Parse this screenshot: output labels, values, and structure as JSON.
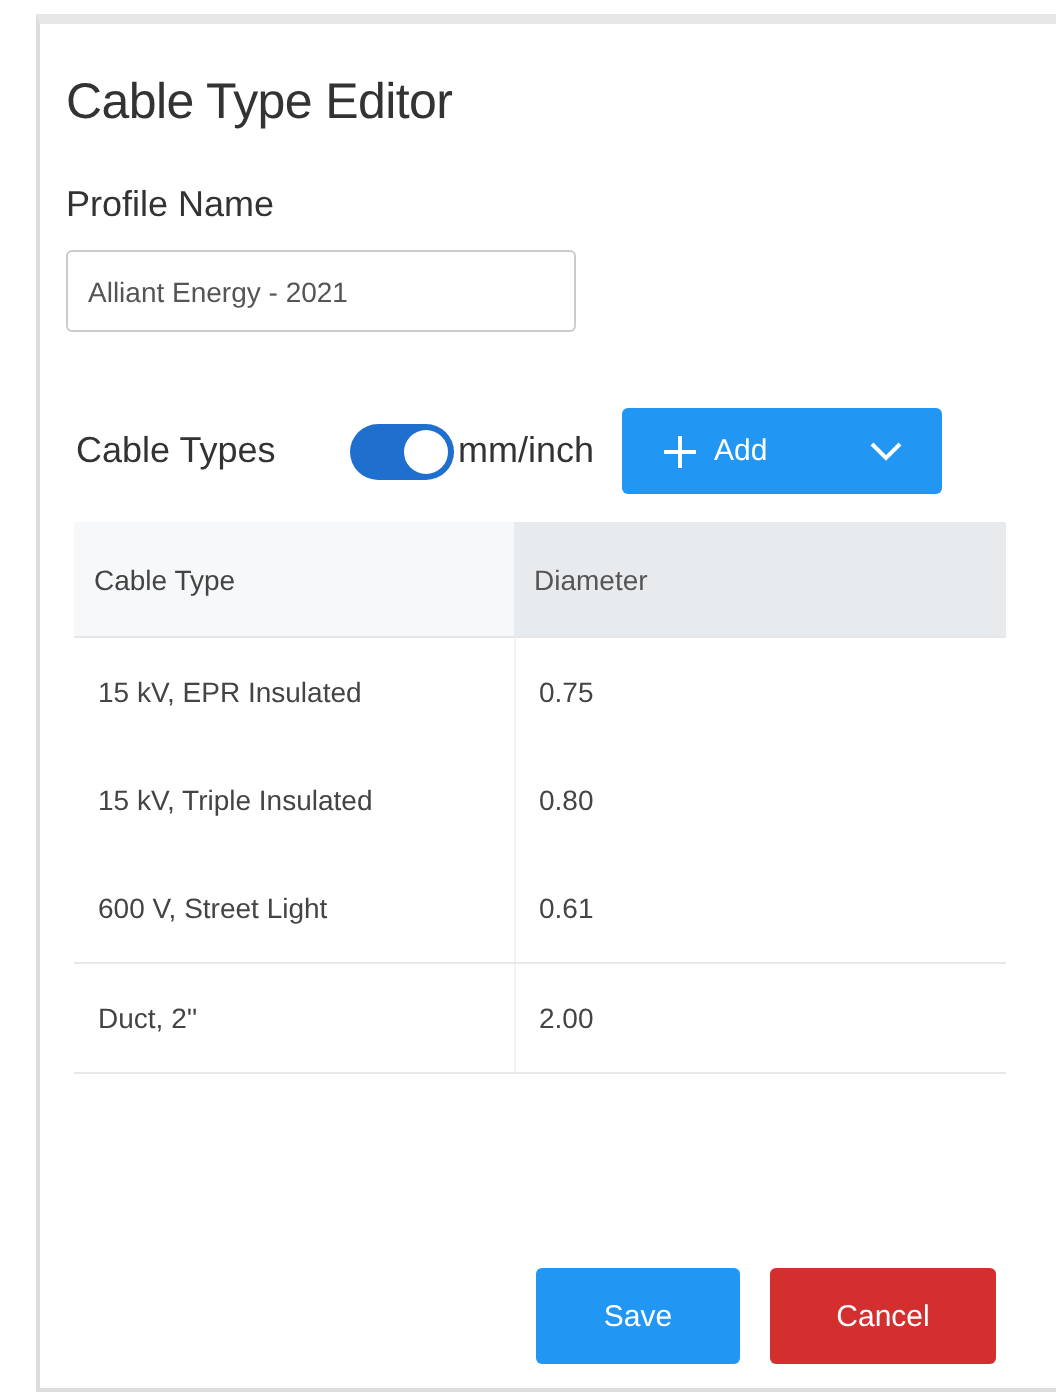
{
  "title": "Cable Type Editor",
  "profile": {
    "label": "Profile Name",
    "value": "Alliant Energy - 2021"
  },
  "cable_types": {
    "label": "Cable Types",
    "toggle": {
      "label": "mm/inch",
      "on": true
    },
    "add_button": "Add"
  },
  "table": {
    "columns": [
      "Cable Type",
      "Diameter"
    ],
    "rows": [
      {
        "cells": [
          "15 kV, EPR Insulated",
          "0.75"
        ]
      },
      {
        "cells": [
          "15 kV, Triple Insulated",
          "0.80"
        ]
      },
      {
        "cells": [
          "600 V, Street Light",
          "0.61"
        ]
      },
      {
        "cells": [
          "Duct, 2''",
          "2.00"
        ]
      }
    ]
  },
  "buttons": {
    "save": "Save",
    "cancel": "Cancel"
  }
}
